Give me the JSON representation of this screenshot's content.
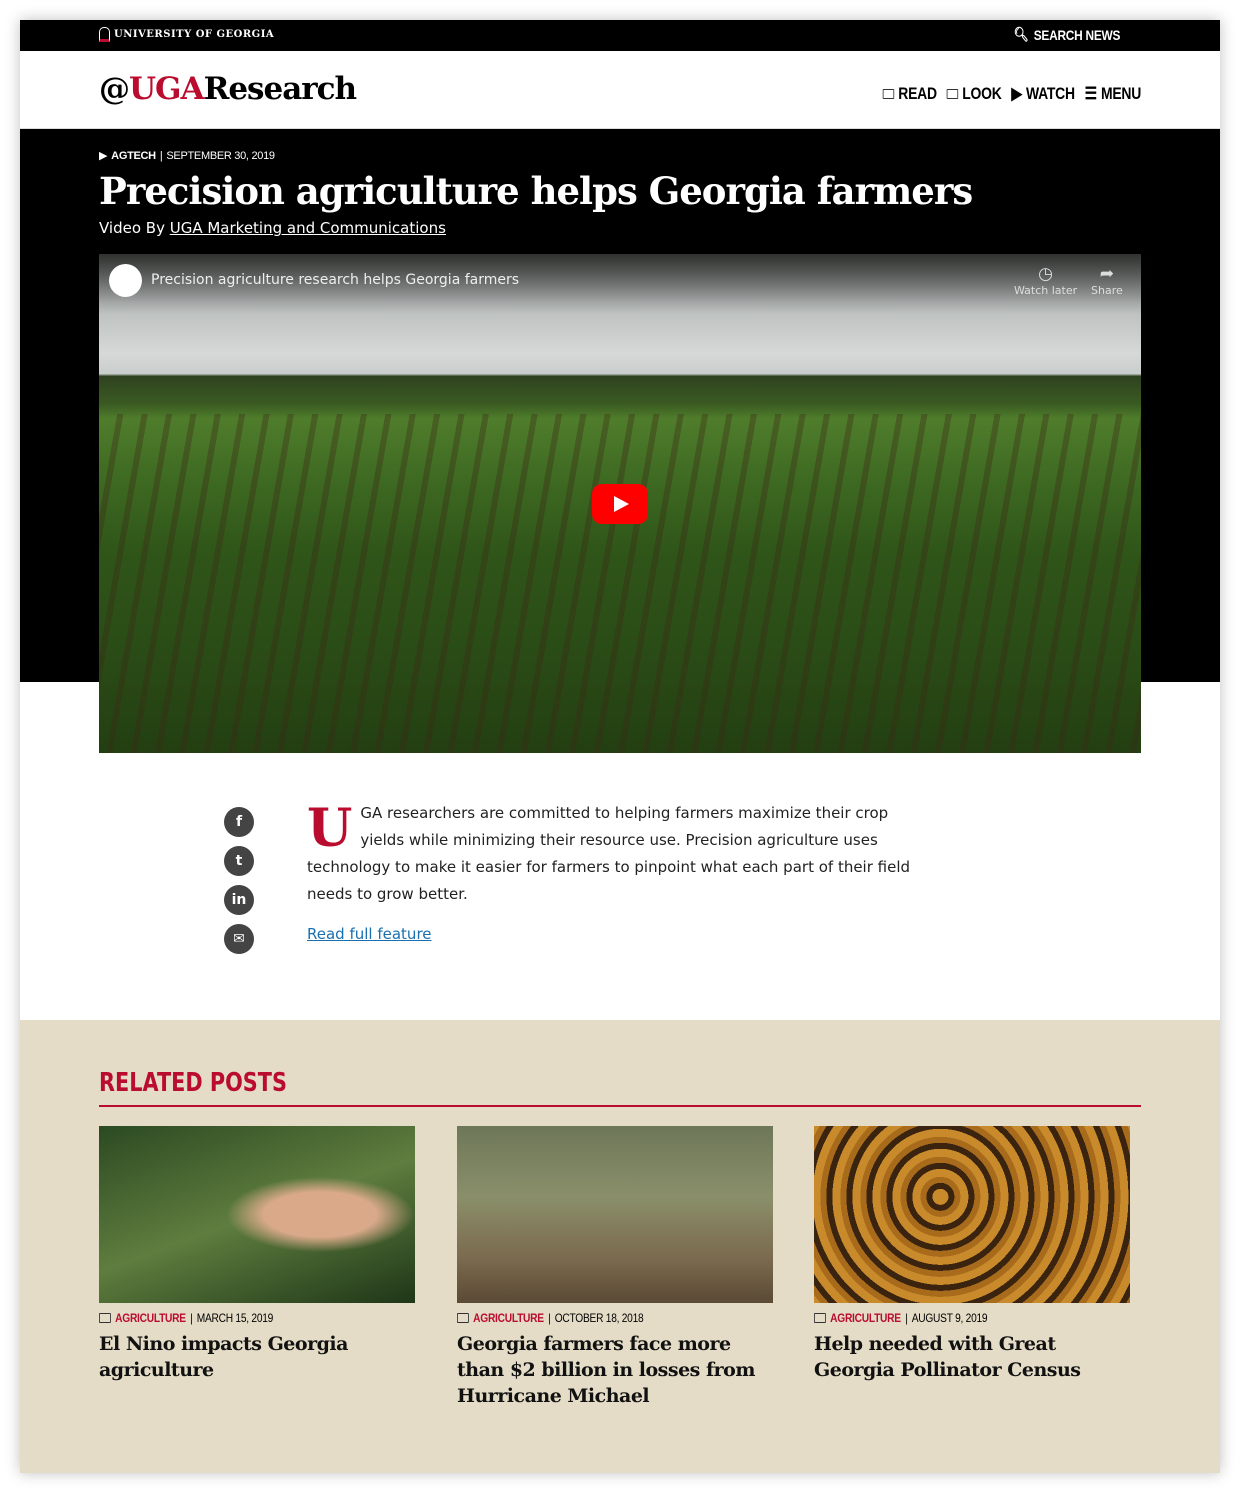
{
  "topbar": {
    "university": "UNIVERSITY OF GEORGIA",
    "search_label": "SEARCH NEWS",
    "search_icon": "search-icon"
  },
  "header": {
    "logo_at": "@",
    "logo_uga": "UGA",
    "logo_research": "Research",
    "nav": [
      {
        "label": "READ",
        "icon": "newspaper-icon"
      },
      {
        "label": "LOOK",
        "icon": "images-icon"
      },
      {
        "label": "WATCH",
        "icon": "play-circle-icon"
      },
      {
        "label": "MENU",
        "icon": "hamburger-icon"
      }
    ]
  },
  "article": {
    "category": "AGTECH",
    "date": "SEPTEMBER 30, 2019",
    "title": "Precision agriculture helps Georgia farmers",
    "byline_prefix": "Video By ",
    "byline_author": "UGA Marketing and Communications",
    "video": {
      "title": "Precision agriculture research helps Georgia farmers",
      "watch_later": "Watch later",
      "share": "Share"
    },
    "drop_cap": "U",
    "body": "GA researchers are committed to helping farmers maximize their crop yields while minimizing their resource use. Precision agriculture uses technology to make it easier for farmers to pinpoint what each part of their field needs to grow better.",
    "read_more": "Read full feature "
  },
  "social": [
    "f",
    "t",
    "in",
    "✉"
  ],
  "related": {
    "heading": "RELATED POSTS",
    "accent": "#ba0c2f",
    "posts": [
      {
        "category": "AGRICULTURE",
        "date": "MARCH 15, 2019",
        "title": "El Nino impacts Georgia agriculture"
      },
      {
        "category": "AGRICULTURE",
        "date": "OCTOBER 18, 2018",
        "title": "Georgia farmers face more than $2 billion in losses from Hurricane Michael"
      },
      {
        "category": "AGRICULTURE",
        "date": "AUGUST 9, 2019",
        "title": "Help needed with Great Georgia Pollinator Census"
      }
    ]
  }
}
